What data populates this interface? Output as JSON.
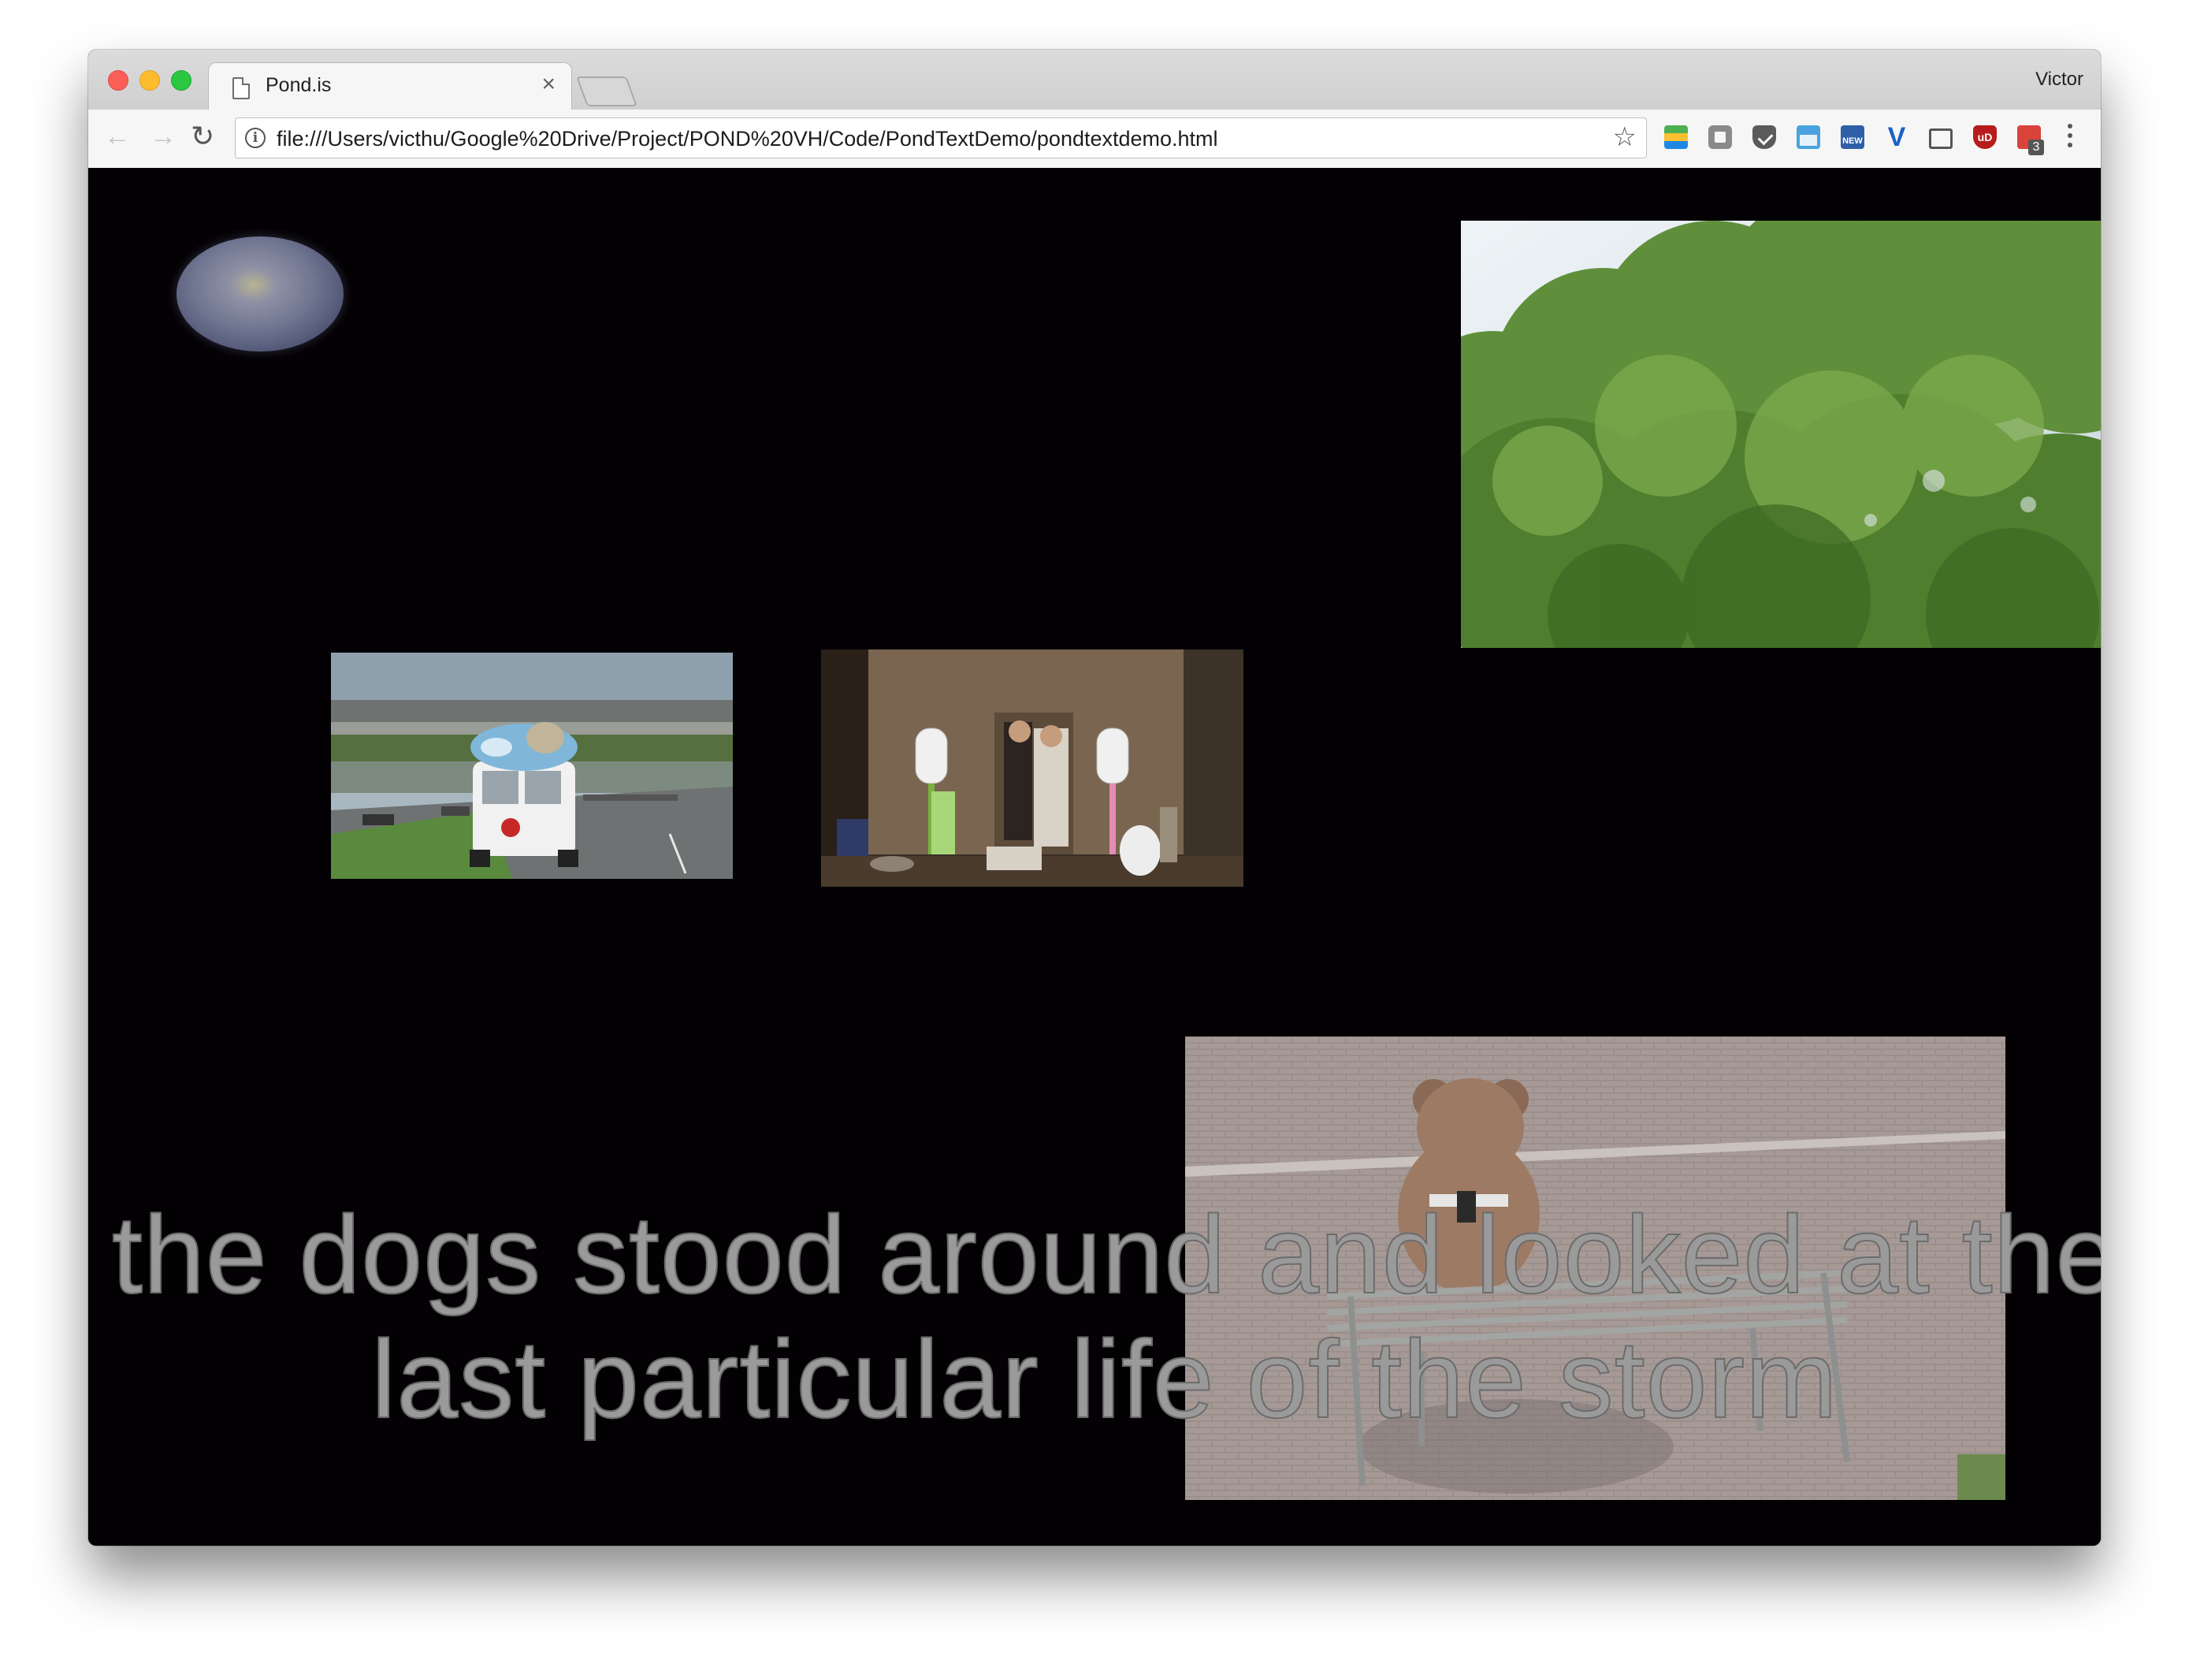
{
  "browser": {
    "tab_title": "Pond.is",
    "tab_close": "×",
    "profile_name": "Victor",
    "url": "file:///Users/victhu/Google%20Drive/Project/POND%20VH/Code/PondTextDemo/pondtextdemo.html",
    "nav": {
      "back": "←",
      "forward": "→",
      "reload": "↻"
    },
    "star": "☆",
    "info": "i",
    "extensions": [
      "google-apps-icon",
      "ext-grey-icon",
      "pocket-icon",
      "window-icon",
      "news-icon",
      "vimeo-icon",
      "mail-check-icon",
      "ublock-icon",
      "gmail-badge-icon"
    ],
    "extension_labels": {
      "news": "NEW",
      "ublock": "uD",
      "gmail_badge": "3"
    },
    "colors": {
      "close": "#fc5f57",
      "minimize": "#fdbc2e",
      "maximize": "#29c840"
    }
  },
  "page": {
    "background": "#040104",
    "poem_lines": [
      "the dogs stood around and looked at the",
      "last particular life of the storm"
    ],
    "media": [
      "pond-blob",
      "trees-video",
      "ice-cream-van-video",
      "shrine-video",
      "bear-bench-video"
    ]
  }
}
